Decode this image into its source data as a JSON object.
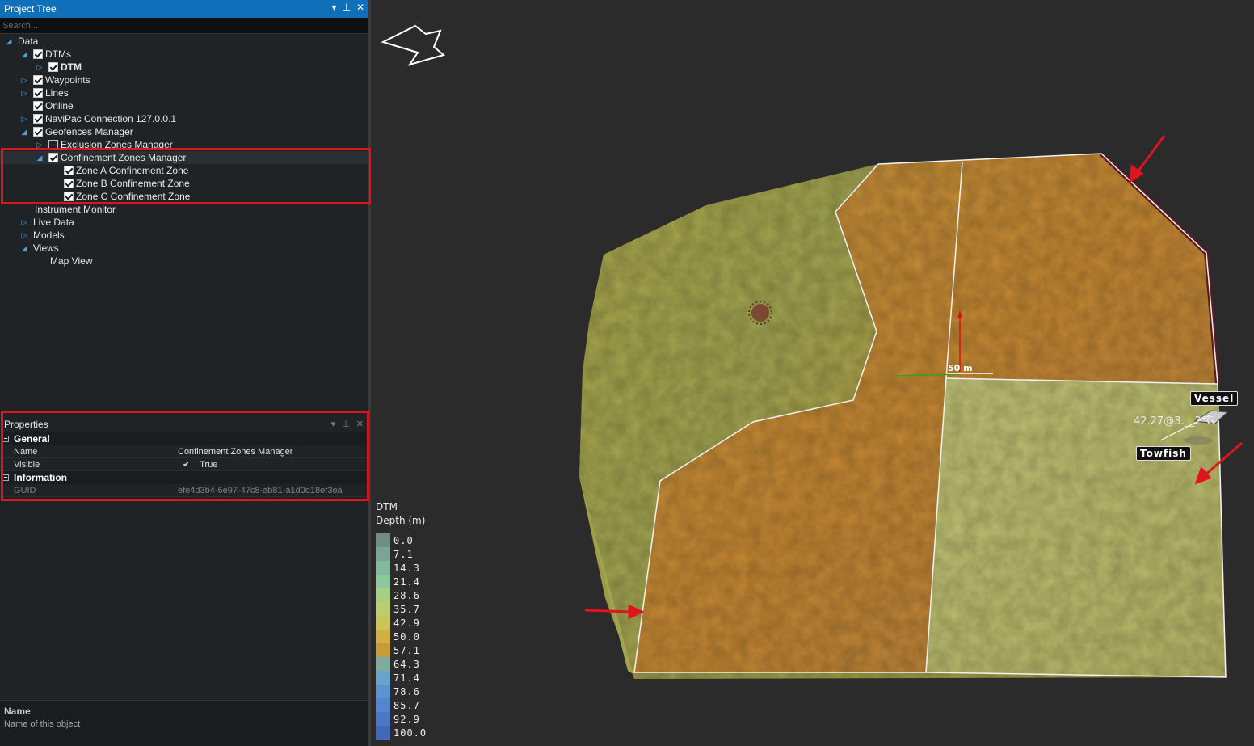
{
  "project_tree": {
    "title": "Project Tree",
    "search_placeholder": "Search...",
    "nodes": [
      {
        "label": "Data"
      },
      {
        "label": "DTMs"
      },
      {
        "label": "DTM"
      },
      {
        "label": "Waypoints"
      },
      {
        "label": "Lines"
      },
      {
        "label": "Online"
      },
      {
        "label": "NaviPac Connection 127.0.0.1"
      },
      {
        "label": "Geofences Manager"
      },
      {
        "label": "Exclusion Zones Manager"
      },
      {
        "label": "Confinement Zones Manager"
      },
      {
        "label": "Zone A Confinement Zone"
      },
      {
        "label": "Zone B Confinement Zone"
      },
      {
        "label": "Zone C Confinement Zone"
      },
      {
        "label": "Instrument Monitor"
      },
      {
        "label": "Live Data"
      },
      {
        "label": "Models"
      },
      {
        "label": "Views"
      },
      {
        "label": "Map View"
      }
    ]
  },
  "properties": {
    "title": "Properties",
    "categories": [
      {
        "name": "General",
        "rows": [
          {
            "key": "Name",
            "value": "Confinement Zones Manager"
          },
          {
            "key": "Visible",
            "value": "True"
          }
        ]
      },
      {
        "name": "Information",
        "rows": [
          {
            "key": "GUID",
            "value": "efe4d3b4-6e97-47c8-ab81-a1d0d18ef3ea"
          }
        ]
      }
    ],
    "description": {
      "title": "Name",
      "text": "Name of this object"
    }
  },
  "map": {
    "legend": {
      "title_line1": "DTM",
      "title_line2": "Depth (m)",
      "entries": [
        {
          "label": "0.0",
          "color": "#6f8f85"
        },
        {
          "label": "7.1",
          "color": "#7aa596"
        },
        {
          "label": "14.3",
          "color": "#84b89e"
        },
        {
          "label": "21.4",
          "color": "#8fc79d"
        },
        {
          "label": "28.6",
          "color": "#a4cf86"
        },
        {
          "label": "35.7",
          "color": "#bccd6c"
        },
        {
          "label": "42.9",
          "color": "#cbc456"
        },
        {
          "label": "50.0",
          "color": "#d2b040"
        },
        {
          "label": "57.1",
          "color": "#c79a3a"
        },
        {
          "label": "64.3",
          "color": "#7faa9c"
        },
        {
          "label": "71.4",
          "color": "#6aa3c9"
        },
        {
          "label": "78.6",
          "color": "#5c94d1"
        },
        {
          "label": "85.7",
          "color": "#5486cf"
        },
        {
          "label": "92.9",
          "color": "#4c77c6"
        },
        {
          "label": "100.0",
          "color": "#4468b8"
        }
      ]
    },
    "scale_label": "50 m",
    "vessel_label": "Vessel",
    "towfish_label": "Towfish",
    "coord_text": "42.27@3.__2°G"
  }
}
